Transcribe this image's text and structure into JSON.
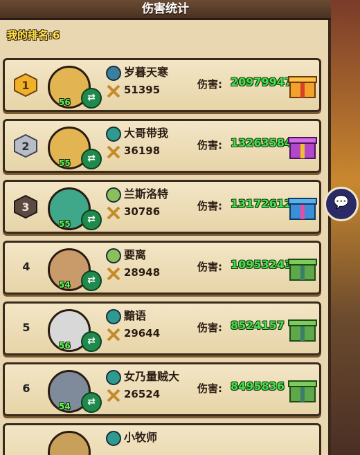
{
  "title": "伤害统计",
  "my_rank": "我的排名:6",
  "damage_label": "伤害:",
  "rows": [
    {
      "rank": "1",
      "level": "56",
      "name": "岁暮天寒",
      "power": "51395",
      "damage": "20979947"
    },
    {
      "rank": "2",
      "level": "55",
      "name": "大哥带我",
      "power": "36198",
      "damage": "13263584"
    },
    {
      "rank": "3",
      "level": "55",
      "name": "兰斯洛特",
      "power": "30786",
      "damage": "13172612"
    },
    {
      "rank": "4",
      "level": "54",
      "name": "要离",
      "power": "28948",
      "damage": "10953243"
    },
    {
      "rank": "5",
      "level": "56",
      "name": "黯语",
      "power": "29644",
      "damage": "8524157"
    },
    {
      "rank": "6",
      "level": "54",
      "name": "女乃量贼大",
      "power": "26524",
      "damage": "8495836"
    },
    {
      "rank": "",
      "level": "",
      "name": "小牧师",
      "power": "",
      "damage": ""
    }
  ],
  "colors": {
    "damage": "#44e14a",
    "level": "#5cff4a",
    "rank_text": "#ffe24a"
  }
}
